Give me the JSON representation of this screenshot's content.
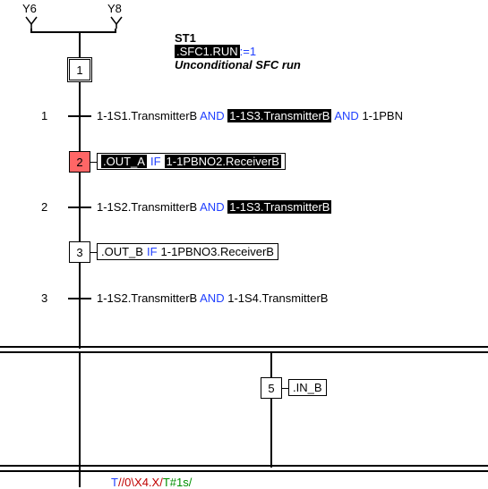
{
  "y": {
    "y6": "Y6",
    "y8": "Y8"
  },
  "header": {
    "st1": "ST1",
    "sfc_token": ".SFC1.RUN",
    "assign": ":=1",
    "subtitle": "Unconditional SFC run"
  },
  "steps": {
    "s1": "1",
    "s2": "2",
    "s3": "3",
    "s5": "5"
  },
  "trans_labels": {
    "t1": "1",
    "t2": "2",
    "t3": "3"
  },
  "transitions": {
    "t1": {
      "a": "1-1S1.TransmitterB",
      "and1": "AND",
      "b": "1-1S3.TransmitterB",
      "and2": "AND",
      "c": "1-1PBN"
    },
    "t2": {
      "a": "1-1S2.TransmitterB",
      "and": "AND",
      "b": "1-1S3.TransmitterB"
    },
    "t3": {
      "a": "1-1S2.TransmitterB",
      "and": "AND",
      "b": "1-1S4.TransmitterB"
    }
  },
  "actions": {
    "a2": {
      "out": ".OUT_A",
      "if": "IF",
      "cond": "1-1PBNO2.ReceiverB"
    },
    "a3": {
      "out": ".OUT_B",
      "if": "IF",
      "cond": "1-1PBNO3.ReceiverB"
    },
    "a5": {
      "out": ".IN_B"
    }
  },
  "footer": {
    "t": "T",
    "mid": "//0\\X4.X/",
    "tail": "T#1s/"
  }
}
